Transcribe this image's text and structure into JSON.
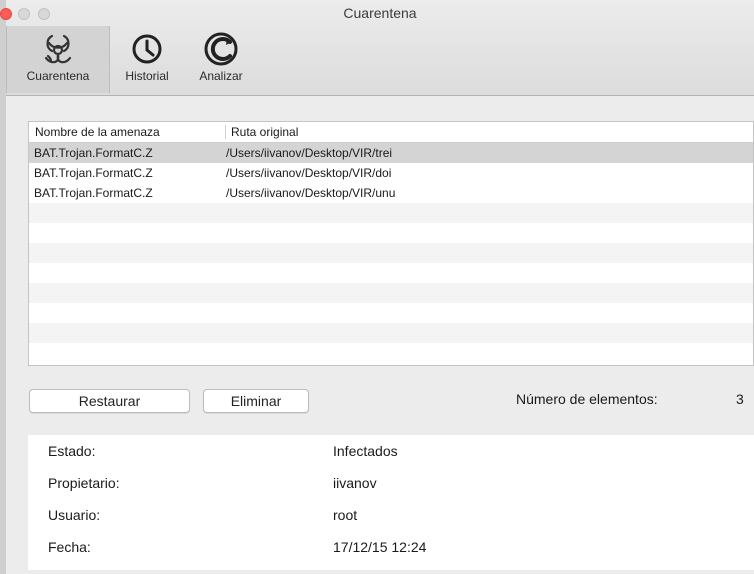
{
  "window": {
    "title": "Cuarentena"
  },
  "toolbar": {
    "items": [
      {
        "label": "Cuarentena",
        "icon": "biohazard-icon",
        "active": true
      },
      {
        "label": "Historial",
        "icon": "clock-icon",
        "active": false
      },
      {
        "label": "Analizar",
        "icon": "scan-icon",
        "active": false
      }
    ]
  },
  "table": {
    "headers": [
      "Nombre de la amenaza",
      "Ruta original"
    ],
    "rows": [
      {
        "threat": "BAT.Trojan.FormatC.Z",
        "path": "/Users/iivanov/Desktop/VIR/trei"
      },
      {
        "threat": "BAT.Trojan.FormatC.Z",
        "path": "/Users/iivanov/Desktop/VIR/doi"
      },
      {
        "threat": "BAT.Trojan.FormatC.Z",
        "path": "/Users/iivanov/Desktop/VIR/unu"
      }
    ]
  },
  "buttons": {
    "restore": "Restaurar",
    "delete": "Eliminar"
  },
  "count": {
    "label": "Número de elementos:",
    "value": "3"
  },
  "details": {
    "rows": [
      {
        "key": "Estado:",
        "value": "Infectados"
      },
      {
        "key": "Propietario:",
        "value": "iivanov"
      },
      {
        "key": "Usuario:",
        "value": "root"
      },
      {
        "key": "Fecha:",
        "value": "17/12/15 12:24"
      }
    ]
  },
  "colors": {
    "close": "#fc5b57",
    "selected_row": "#d4d4d4",
    "window_bg": "#ececec"
  }
}
